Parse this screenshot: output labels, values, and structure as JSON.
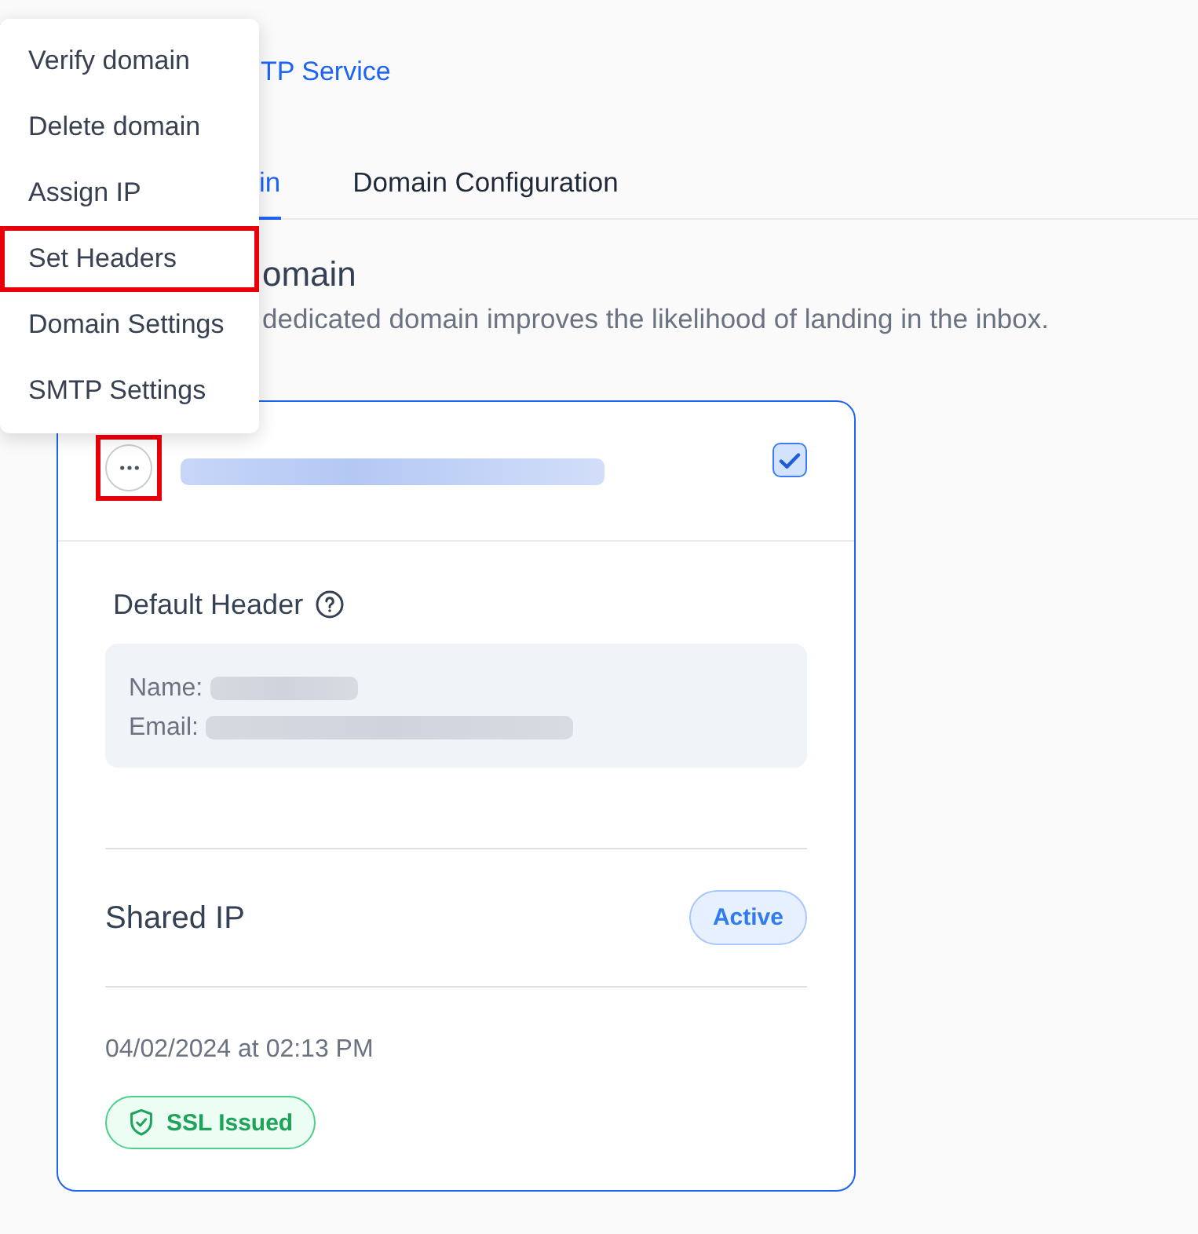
{
  "context_menu": {
    "items": [
      {
        "label": "Verify domain",
        "highlighted": false
      },
      {
        "label": "Delete domain",
        "highlighted": false
      },
      {
        "label": "Assign IP",
        "highlighted": false
      },
      {
        "label": "Set Headers",
        "highlighted": true
      },
      {
        "label": "Domain Settings",
        "highlighted": false
      },
      {
        "label": "SMTP Settings",
        "highlighted": false
      }
    ]
  },
  "breadcrumb": {
    "text": "TP Service"
  },
  "tabs": [
    {
      "label": "in",
      "selected": true
    },
    {
      "label": "Domain Configuration",
      "selected": false
    }
  ],
  "section": {
    "title": "omain",
    "description": "dedicated domain improves the likelihood of landing in the inbox."
  },
  "domain_card": {
    "more_button": {
      "highlighted": true
    },
    "domain": {
      "redacted": true
    },
    "checked": true,
    "default_header": {
      "title": "Default Header",
      "fields": [
        {
          "label": "Name:",
          "redacted": true
        },
        {
          "label": "Email:",
          "redacted": true
        }
      ]
    },
    "ip": {
      "label": "Shared IP",
      "status": "Active"
    },
    "date": "04/02/2024 at 02:13 PM",
    "ssl_badge": "SSL Issued"
  }
}
